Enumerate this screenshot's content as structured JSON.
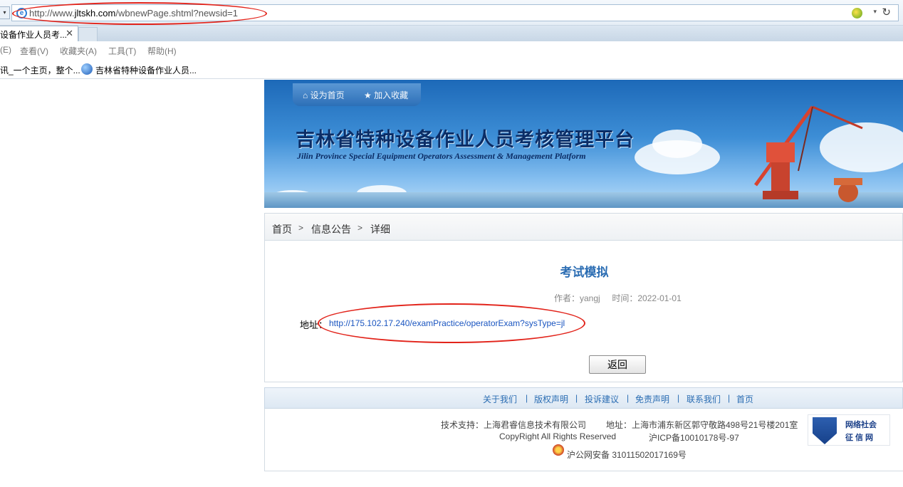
{
  "browser": {
    "address_url_prefix": "http://www.",
    "address_url_domain": "jltskh.com",
    "address_url_path": "/wbnewPage.shtml?newsid=1",
    "tab_title": "设备作业人员考...",
    "tab_close": "✕",
    "menu": [
      "(E)",
      "查看(V)",
      "收藏夹(A)",
      "工具(T)",
      "帮助(H)"
    ],
    "favorites": [
      "讯_一个主页，整个...",
      "吉林省特种设备作业人员..."
    ],
    "icons": {
      "ie": "ie-logo-icon",
      "refresh": "↻",
      "dropdown": "▾",
      "nav_dropdown": "▾",
      "annotation_color": "#e2231a"
    }
  },
  "banner": {
    "set_home": "设为首页",
    "add_favorite": "加入收藏",
    "title": "吉林省特种设备作业人员考核管理平台",
    "subtitle": "Jilin Province Special Equipment Operators Assessment & Management Platform"
  },
  "breadcrumb": {
    "items": [
      "首页",
      "信息公告",
      "详细"
    ],
    "separator": ">"
  },
  "article": {
    "title": "考试模拟",
    "author_label": "作者：yangj",
    "time_label": "时间：2022-01-01",
    "address_label": "地址：",
    "address_link": "http://175.102.17.240/examPractice/operatorExam?sysType=jl",
    "back_button": "返回"
  },
  "footer": {
    "links": [
      "关于我们",
      "版权声明",
      "投诉建议",
      "免责声明",
      "联系我们",
      "首页"
    ],
    "separator": "|",
    "tech_support": "技术支持：上海君睿信息技术有限公司",
    "address": "地址：上海市浦东新区郭守敬路498号21号楼201室",
    "copyright": "CopyRight All Rights Reserved",
    "icp": "沪ICP备10010178号-97",
    "police": "沪公网安备 31011502017169号",
    "cred_line1": "网络社会",
    "cred_line2": "征信网"
  },
  "colors": {
    "link_blue": "#2b6db3",
    "annotation_red": "#e2231a",
    "banner_title": "#0b2d66"
  }
}
